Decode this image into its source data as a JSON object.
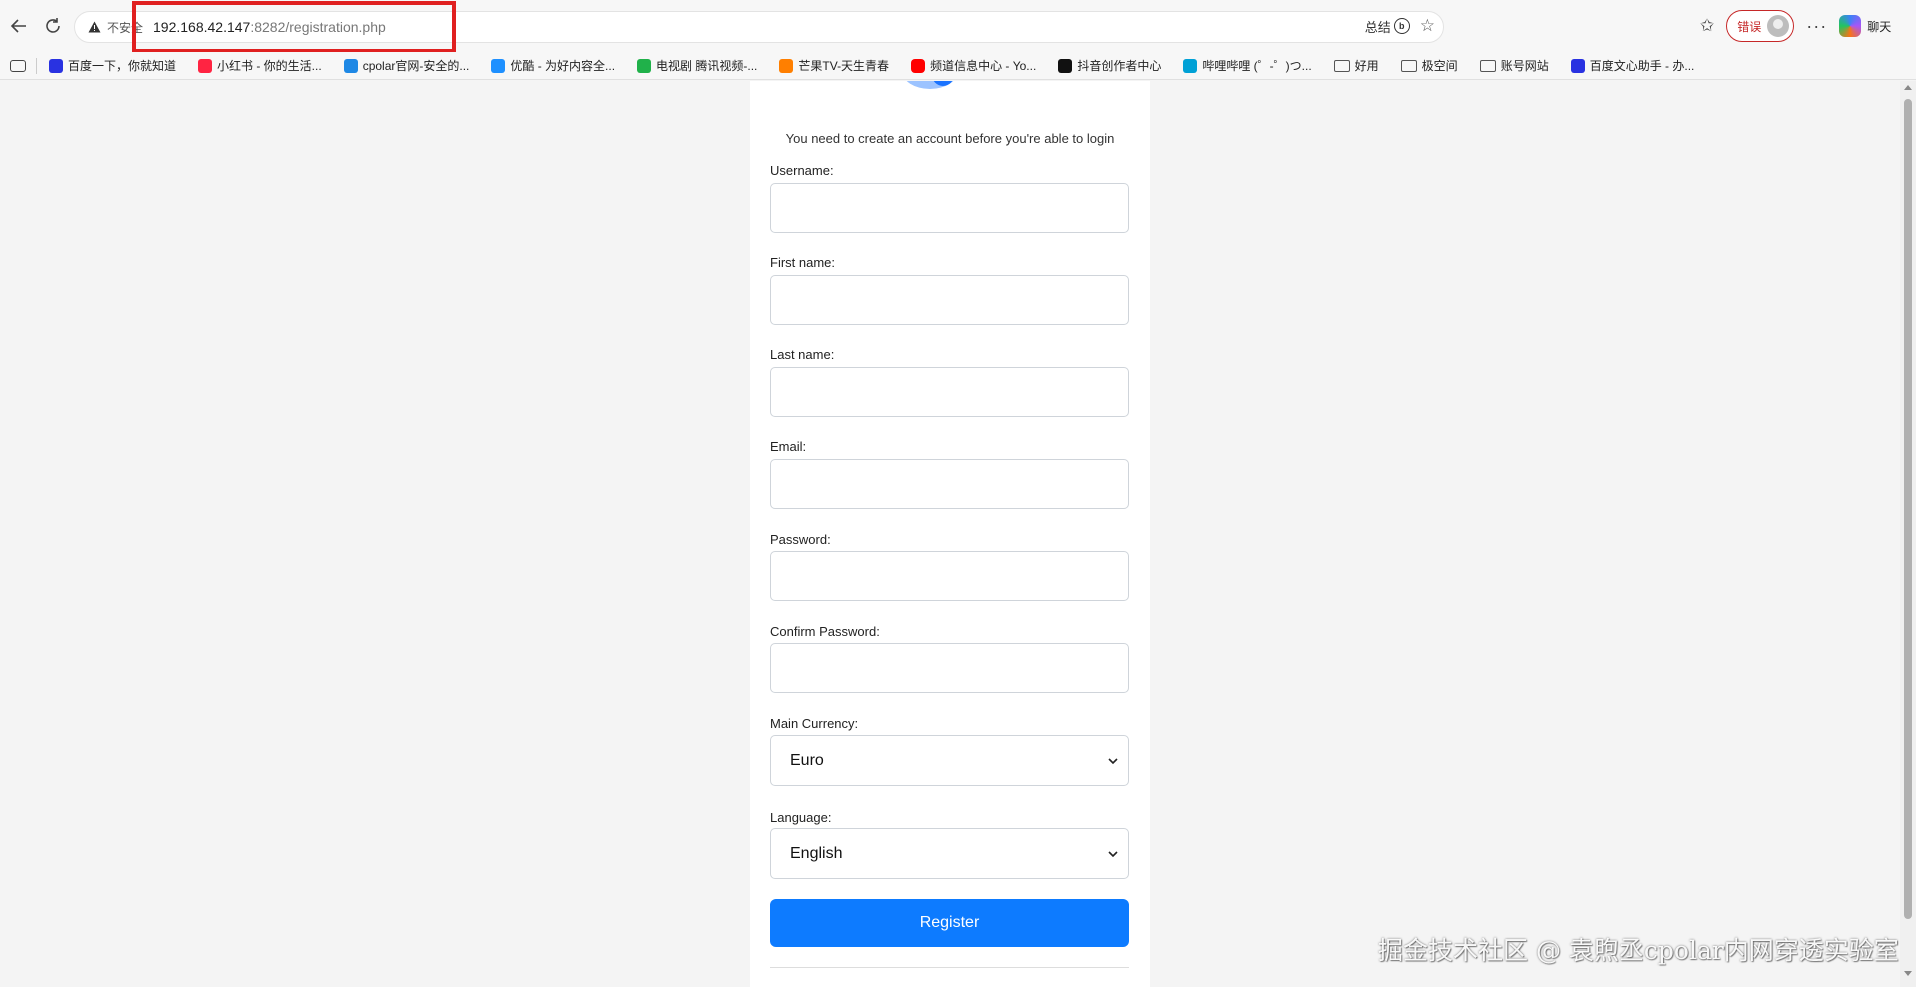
{
  "browser": {
    "insecure_label": "不安全",
    "url_host": "192.168.42.147",
    "url_rest": ":8282/registration.php",
    "summary_label": "总结",
    "error_label": "错误",
    "chat_label": "聊天"
  },
  "bookmarks": [
    {
      "label": "百度一下，你就知道",
      "icon": "baidu-paw-icon",
      "color": "#2932e1"
    },
    {
      "label": "小红书 - 你的生活...",
      "icon": "xiaohongshu-icon",
      "color": "#ff2442"
    },
    {
      "label": "cpolar官网-安全的...",
      "icon": "cpolar-icon",
      "color": "#1e88e5"
    },
    {
      "label": "优酷 - 为好内容全...",
      "icon": "youku-icon",
      "color": "#1e90ff"
    },
    {
      "label": "电视剧 腾讯视频-...",
      "icon": "tencent-video-icon",
      "color": "#20b14a"
    },
    {
      "label": "芒果TV-天生青春",
      "icon": "mango-tv-icon",
      "color": "#ff7f00"
    },
    {
      "label": "频道信息中心 - Yo...",
      "icon": "youtube-icon",
      "color": "#ff0000"
    },
    {
      "label": "抖音创作者中心",
      "icon": "douyin-icon",
      "color": "#111111"
    },
    {
      "label": "哔哩哔哩 (゜-゜)つ...",
      "icon": "bilibili-icon",
      "color": "#00a1d6"
    },
    {
      "label": "好用",
      "icon": "folder-icon",
      "color": "#555555"
    },
    {
      "label": "极空间",
      "icon": "folder-icon",
      "color": "#555555"
    },
    {
      "label": "账号网站",
      "icon": "folder-icon",
      "color": "#555555"
    },
    {
      "label": "百度文心助手 - 办...",
      "icon": "baidu-paw-icon",
      "color": "#2932e1"
    }
  ],
  "form": {
    "lead": "You need to create an account before you're able to login",
    "username_label": "Username:",
    "first_name_label": "First name:",
    "last_name_label": "Last name:",
    "email_label": "Email:",
    "password_label": "Password:",
    "confirm_password_label": "Confirm Password:",
    "currency_label": "Main Currency:",
    "currency_value": "Euro",
    "language_label": "Language:",
    "language_value": "English",
    "register_label": "Register"
  },
  "colors": {
    "accent": "#0d7bff",
    "highlight_box": "#e02020",
    "logo_blue": "#1a73ff",
    "logo_light_blue": "#9cc3ff"
  },
  "watermark": "掘金技术社区 @ 袁煦丞cpolar内网穿透实验室"
}
